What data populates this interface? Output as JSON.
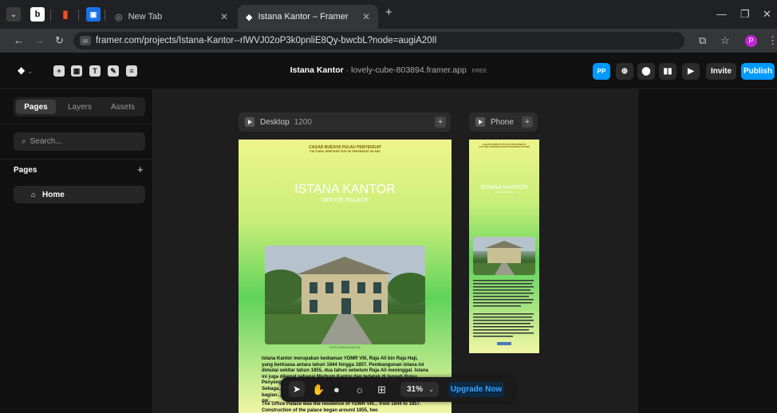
{
  "browser": {
    "tabs": [
      {
        "label": "New Tab",
        "icon": "chrome-icon"
      },
      {
        "label": "Istana Kantor – Framer",
        "icon": "framer-icon"
      }
    ],
    "url": "framer.com/projects/Istana-Kantor--rlWVJ02oP3k0pnliE8Qy-bwcbL?node=augiA20Il",
    "profile_initial": "P"
  },
  "framer": {
    "project_name": "Istana Kantor",
    "project_domain": "· lovely-cube-803894.framer.app",
    "plan_badge": "FREE",
    "user_badge": "PP",
    "invite_label": "Invite",
    "publish_label": "Publish",
    "accent": "#0099ff"
  },
  "left_panel": {
    "tabs": [
      "Pages",
      "Layers",
      "Assets"
    ],
    "active_tab": "Pages",
    "search_placeholder": "Search...",
    "pages_heading": "Pages",
    "pages": [
      "Home"
    ]
  },
  "canvas": {
    "frames": [
      {
        "label": "Desktop",
        "size": "1200"
      },
      {
        "label": "Phone"
      }
    ],
    "site": {
      "caption_line1": "CAGAR BUDAYA PULAU PENYENGAT",
      "caption_line2": "CULTURAL HERITAGE SITE OF PENYENGAT ISLAND",
      "title": "ISTANA KANTOR",
      "subtitle": "OFFICE PALACE",
      "photo_caption": "FOTO ISTANA KANTOR",
      "paragraph_id": "Istana Kantor merupakan kediaman YDMR VIII, Raja Ali bin Raja Haji, yang berkuasa antara tahun 1844 hingga 1857. Pembangunan istana ini dimulai sekitar tahun 1855, dua tahun sebelum Raja Ali meninggal. Istana ini juga dikenal sebagai Marhum Kantor dan terletak di tengah Pulau Penyengat, yang te...",
      "paragraph_id_tail": "Sebaga... bagian... yang ow...",
      "paragraph_en": "The Office Palace was the residence of YDMR VIII... from 1844 to 1857. Construction of the palace began around 1855, two"
    }
  },
  "floatbar": {
    "zoom": "31%",
    "upgrade_label": "Upgrade Now"
  }
}
